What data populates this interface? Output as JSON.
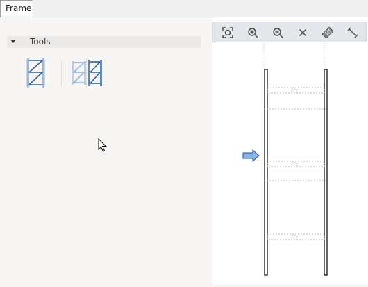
{
  "tabs": [
    {
      "label": "Frame"
    }
  ],
  "tools_panel": {
    "header": "Tools",
    "items": [
      {
        "icon": "single-frame-icon"
      },
      {
        "icon": "double-frame-icon"
      }
    ]
  },
  "viewer_toolbar": {
    "buttons": [
      {
        "icon": "zoom-extents-icon"
      },
      {
        "icon": "zoom-in-icon"
      },
      {
        "icon": "zoom-out-icon"
      },
      {
        "icon": "close-icon"
      },
      {
        "icon": "eraser-icon"
      },
      {
        "icon": "measure-icon"
      }
    ]
  },
  "colors": {
    "accent_blue": "#2f5f8f",
    "light_blue": "#8fb3d8",
    "arrow_fill": "#8ab4e8",
    "toolbar_bg": "#e3e6ea"
  }
}
